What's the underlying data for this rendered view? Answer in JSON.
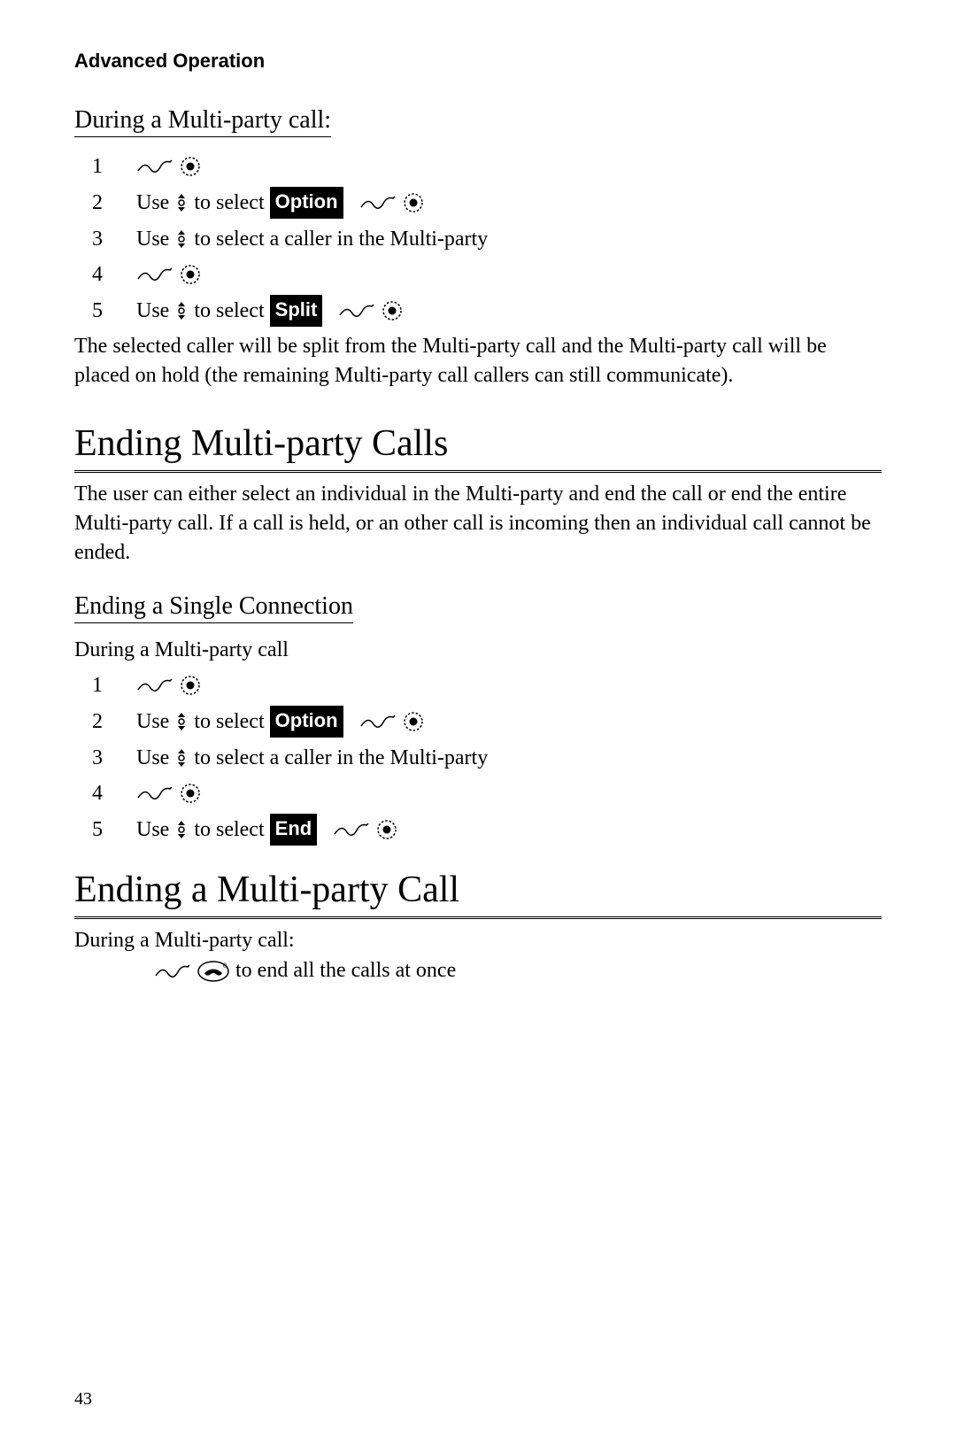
{
  "header": {
    "chapter": "Advanced Operation"
  },
  "section1": {
    "title": "During a Multi-party call:",
    "steps": {
      "s1": "1",
      "s2": "2",
      "s2_use": "Use",
      "s2_select": " to select ",
      "s2_option": "Option",
      "s3": "3",
      "s3_use": "Use",
      "s3_rest": " to select a caller in the Multi-party",
      "s4": "4",
      "s5": "5",
      "s5_use": "Use",
      "s5_select": " to select ",
      "s5_split": "Split"
    },
    "body": "The selected caller will be split from the Multi-party call and the Multi-party call will be placed on hold (the remaining Multi-party call callers can still communicate)."
  },
  "section2": {
    "title": "Ending Multi-party Calls",
    "body": "The user can either select an individual in the Multi-party and end the call or end the entire Multi-party call. If a call is held, or an other call is incoming then an individual call cannot be ended."
  },
  "section3": {
    "title": "Ending a Single Connection",
    "intro": "During a Multi-party call",
    "steps": {
      "s1": "1",
      "s2": "2",
      "s2_use": "Use",
      "s2_select": " to select ",
      "s2_option": "Option",
      "s3": "3",
      "s3_use": "Use",
      "s3_rest": " to select a caller in the Multi-party",
      "s4": "4",
      "s5": "5",
      "s5_use": "Use",
      "s5_select": " to select ",
      "s5_end": "End"
    }
  },
  "section4": {
    "title": "Ending a Multi-party Call",
    "intro": "During a Multi-party call:",
    "end_text": " to end all the calls at once"
  },
  "page_number": "43"
}
